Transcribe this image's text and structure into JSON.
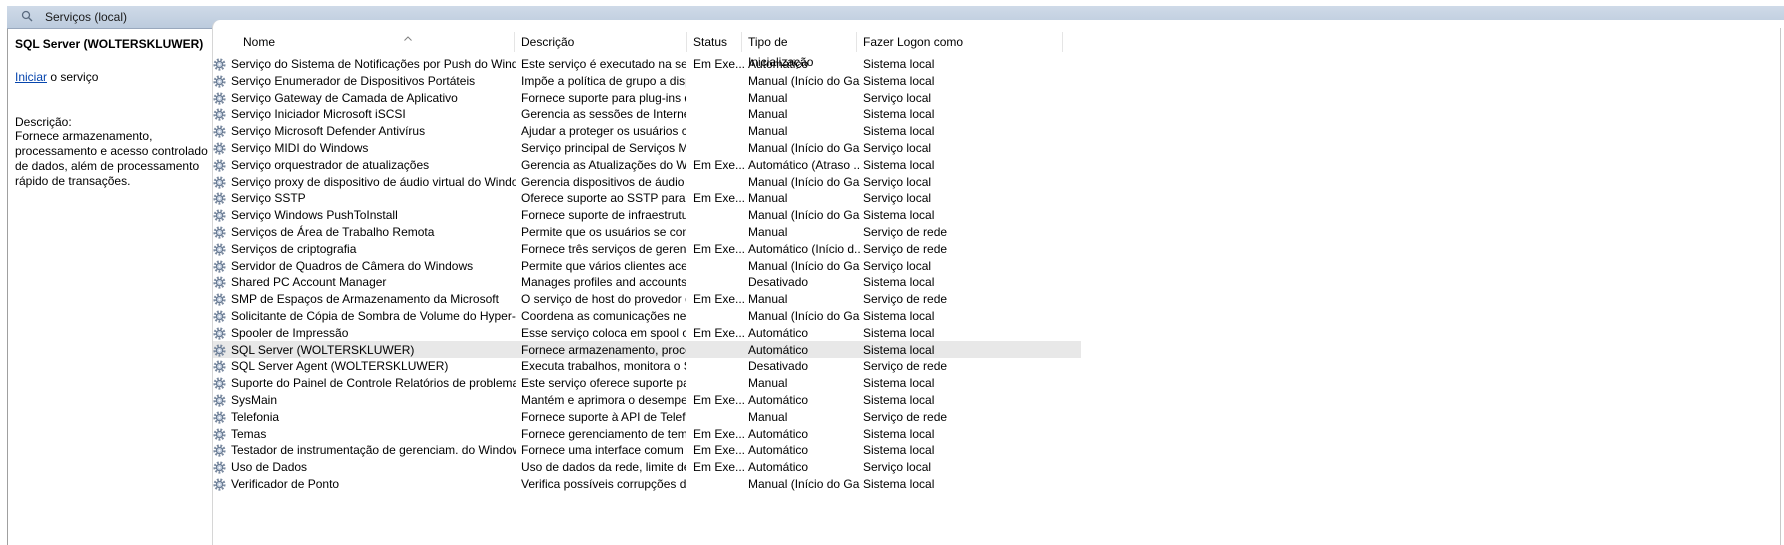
{
  "window": {
    "title": "Serviços (local)"
  },
  "left_pane": {
    "service_title": "SQL Server (WOLTERSKLUWER)",
    "action_link": "Iniciar",
    "action_suffix": " o serviço",
    "desc_label": "Descrição:",
    "description": "Fornece armazenamento, processamento e acesso controlado de dados, além de processamento rápido de transações."
  },
  "columns": [
    "Nome",
    "Descrição",
    "Status",
    "Tipo de Inicialização",
    "Fazer Logon como"
  ],
  "rows": [
    {
      "name": "Serviço do Sistema de Notificações por Push do Windows",
      "desc": "Este serviço é executado na sessã...",
      "status": "Em Exe...",
      "type": "Automático",
      "logon": "Sistema local"
    },
    {
      "name": "Serviço Enumerador de Dispositivos Portáteis",
      "desc": "Impõe a política de grupo a disp...",
      "status": "",
      "type": "Manual (Início do Ga...",
      "logon": "Sistema local"
    },
    {
      "name": "Serviço Gateway de Camada de Aplicativo",
      "desc": "Fornece suporte para plug-ins de ...",
      "status": "",
      "type": "Manual",
      "logon": "Serviço local"
    },
    {
      "name": "Serviço Iniciador Microsoft iSCSI",
      "desc": "Gerencia as sessões de Internet S...",
      "status": "",
      "type": "Manual",
      "logon": "Sistema local"
    },
    {
      "name": "Serviço Microsoft Defender Antivírus",
      "desc": "Ajudar a proteger os usuários co...",
      "status": "",
      "type": "Manual",
      "logon": "Sistema local"
    },
    {
      "name": "Serviço MIDI do Windows",
      "desc": "Serviço principal de Serviços MID...",
      "status": "",
      "type": "Manual (Início do Ga...",
      "logon": "Serviço local"
    },
    {
      "name": "Serviço orquestrador de atualizações",
      "desc": "Gerencia as Atualizações do Win...",
      "status": "Em Exe...",
      "type": "Automático (Atraso ...",
      "logon": "Sistema local"
    },
    {
      "name": "Serviço proxy de dispositivo de áudio virtual do Windows",
      "desc": "Gerencia dispositivos de áudio vi...",
      "status": "",
      "type": "Manual (Início do Ga...",
      "logon": "Serviço local"
    },
    {
      "name": "Serviço SSTP",
      "desc": "Oferece suporte ao SSTP para co...",
      "status": "Em Exe...",
      "type": "Manual",
      "logon": "Serviço local"
    },
    {
      "name": "Serviço Windows PushToInstall",
      "desc": "Fornece suporte de infraestrutur...",
      "status": "",
      "type": "Manual (Início do Ga...",
      "logon": "Sistema local"
    },
    {
      "name": "Serviços de Área de Trabalho Remota",
      "desc": "Permite que os usuários se cone...",
      "status": "",
      "type": "Manual",
      "logon": "Serviço de rede"
    },
    {
      "name": "Serviços de criptografia",
      "desc": "Fornece três serviços de gerencia...",
      "status": "Em Exe...",
      "type": "Automático (Início d...",
      "logon": "Serviço de rede"
    },
    {
      "name": "Servidor de Quadros de Câmera do Windows",
      "desc": "Permite que vários clientes acess...",
      "status": "",
      "type": "Manual (Início do Ga...",
      "logon": "Serviço local"
    },
    {
      "name": "Shared PC Account Manager",
      "desc": "Manages profiles and accounts o...",
      "status": "",
      "type": "Desativado",
      "logon": "Sistema local"
    },
    {
      "name": "SMP de Espaços de Armazenamento da Microsoft",
      "desc": "O serviço de host do provedor d...",
      "status": "Em Exe...",
      "type": "Manual",
      "logon": "Serviço de rede"
    },
    {
      "name": "Solicitante de Cópia de Sombra de Volume do Hyper-V",
      "desc": "Coordena as comunicações nece...",
      "status": "",
      "type": "Manual (Início do Ga...",
      "logon": "Sistema local"
    },
    {
      "name": "Spooler de Impressão",
      "desc": "Esse serviço coloca em spool os t...",
      "status": "Em Exe...",
      "type": "Automático",
      "logon": "Sistema local"
    },
    {
      "name": "SQL Server (WOLTERSKLUWER)",
      "desc": "Fornece armazenamento, proces...",
      "status": "",
      "type": "Automático",
      "logon": "Sistema local",
      "selected": true
    },
    {
      "name": "SQL Server Agent (WOLTERSKLUWER)",
      "desc": "Executa trabalhos, monitora o S...",
      "status": "",
      "type": "Desativado",
      "logon": "Serviço de rede"
    },
    {
      "name": "Suporte do Painel de Controle Relatórios de problemas",
      "desc": "Este serviço oferece suporte para...",
      "status": "",
      "type": "Manual",
      "logon": "Sistema local"
    },
    {
      "name": "SysMain",
      "desc": "Mantém e aprimora o desempen...",
      "status": "Em Exe...",
      "type": "Automático",
      "logon": "Sistema local"
    },
    {
      "name": "Telefonia",
      "desc": "Fornece suporte à API de Telefon...",
      "status": "",
      "type": "Manual",
      "logon": "Serviço de rede"
    },
    {
      "name": "Temas",
      "desc": "Fornece gerenciamento de tema...",
      "status": "Em Exe...",
      "type": "Automático",
      "logon": "Sistema local"
    },
    {
      "name": "Testador de instrumentação de gerenciam. do Windows",
      "desc": "Fornece uma interface comum e...",
      "status": "Em Exe...",
      "type": "Automático",
      "logon": "Sistema local"
    },
    {
      "name": "Uso de Dados",
      "desc": "Uso de dados da rede, limite de ...",
      "status": "Em Exe...",
      "type": "Automático",
      "logon": "Serviço local"
    },
    {
      "name": "Verificador de Ponto",
      "desc": "Verifica possíveis corrupções do ...",
      "status": "",
      "type": "Manual (Início do Ga...",
      "logon": "Sistema local"
    }
  ]
}
